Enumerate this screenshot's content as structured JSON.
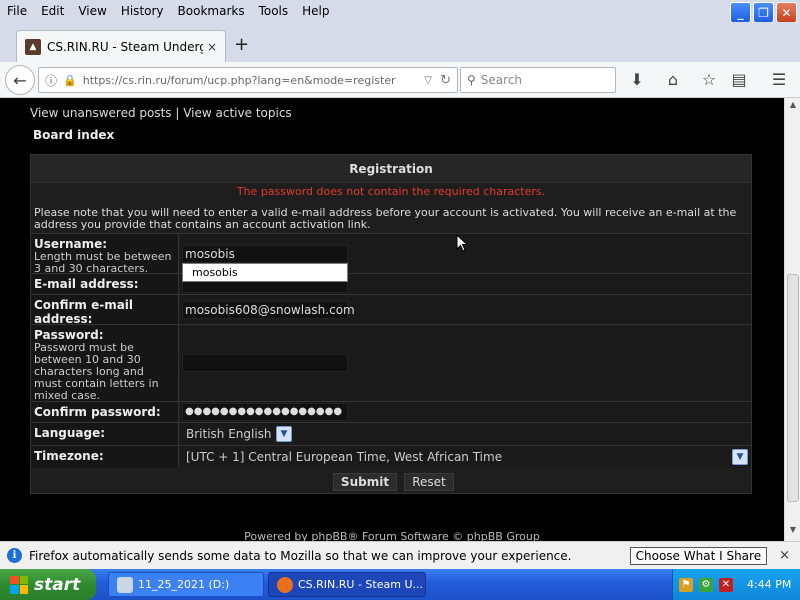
{
  "menubar": {
    "items": [
      "File",
      "Edit",
      "View",
      "History",
      "Bookmarks",
      "Tools",
      "Help"
    ]
  },
  "tab": {
    "title": "CS.RIN.RU - Steam Undergro...",
    "close": "×",
    "new_tab": "+"
  },
  "navbar": {
    "url": "https://cs.rin.ru/forum/ucp.php?lang=en&mode=register",
    "search_placeholder": "Search"
  },
  "page": {
    "top_links": "View unanswered posts | View active topics",
    "board_index": "Board index",
    "title": "Registration",
    "error": "The password does not contain the required characters.",
    "note": "Please note that you will need to enter a valid e-mail address before your account is activated. You will receive an e-mail at the address you provide that contains an account activation link.",
    "fields": {
      "username_label": "Username:",
      "username_help": "Length must be between 3 and 30 characters.",
      "username_value": "mosobis",
      "email_label": "E-mail address:",
      "email_value": "",
      "confirm_email_label": "Confirm e-mail address:",
      "confirm_email_value": "mosobis608@snowlash.com",
      "password_label": "Password:",
      "password_help": "Password must be between 10 and 30 characters long and must contain letters in mixed case.",
      "password_value": "",
      "confirm_password_label": "Confirm password:",
      "confirm_password_value": "●●●●●●●●●●●●●●●●●●",
      "language_label": "Language:",
      "language_value": "British English",
      "timezone_label": "Timezone:",
      "timezone_value": "[UTC + 1] Central European Time, West African Time"
    },
    "autocomplete_suggestion": "mosobis",
    "submit_label": "Submit",
    "reset_label": "Reset",
    "footer": "Powered by phpBB® Forum Software © phpBB Group"
  },
  "notification": {
    "message": "Firefox automatically sends some data to Mozilla so that we can improve your experience.",
    "button": "Choose What I Share",
    "close": "×"
  },
  "taskbar": {
    "start": "start",
    "item1": "11_25_2021 (D:)",
    "item2": "CS.RIN.RU - Steam U...",
    "clock": "4:44 PM"
  },
  "colors": {
    "error": "#e03a2a",
    "page_bg": "#000000",
    "taskbar": "#245edb",
    "start": "#2e8b2e"
  }
}
